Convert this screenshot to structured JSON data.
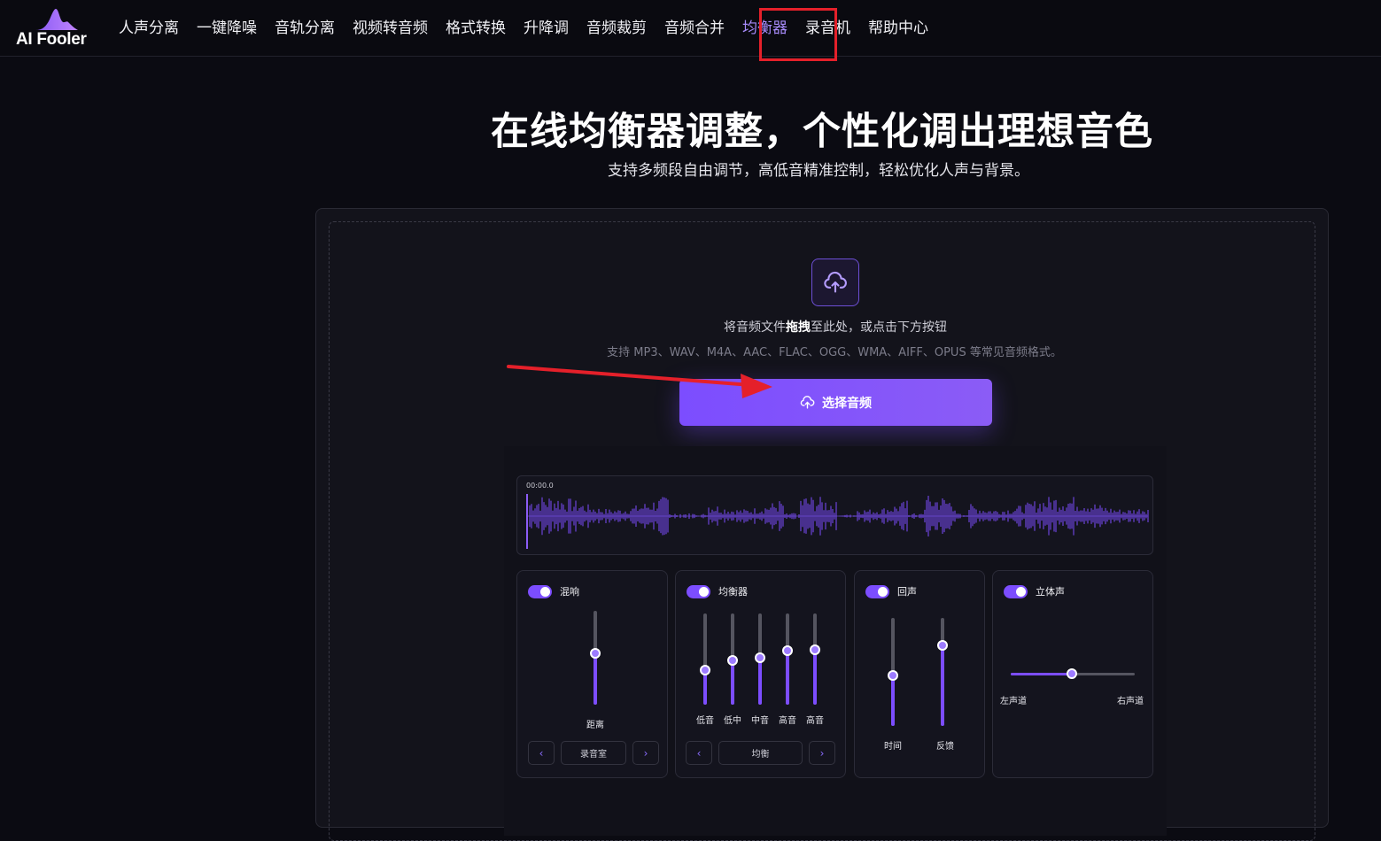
{
  "brand": {
    "name": "AI Fooler"
  },
  "nav": {
    "items": [
      "人声分离",
      "一键降噪",
      "音轨分离",
      "视频转音频",
      "格式转换",
      "升降调",
      "音频裁剪",
      "音频合并",
      "均衡器",
      "录音机",
      "帮助中心"
    ],
    "active_index": 8
  },
  "hero": {
    "title": "在线均衡器调整，个性化调出理想音色",
    "subtitle": "支持多频段自由调节，高低音精准控制，轻松优化人声与背景。"
  },
  "upload": {
    "drop_prefix": "将音频文件",
    "drop_bold": "拖拽",
    "drop_suffix": "至此处，或点击下方按钮",
    "formats": "支持 MP3、WAV、M4A、AAC、FLAC、OGG、WMA、AIFF、OPUS 等常见音频格式。",
    "button_label": "选择音频"
  },
  "preview": {
    "time": "00:00.0",
    "reverb": {
      "title": "混响",
      "enabled": true,
      "distance_label": "距离",
      "distance_level": 0.55,
      "preset": "录音室"
    },
    "equalizer": {
      "title": "均衡器",
      "enabled": true,
      "bands": [
        {
          "label": "低音",
          "level": 0.38
        },
        {
          "label": "低中",
          "level": 0.49
        },
        {
          "label": "中音",
          "level": 0.51
        },
        {
          "label": "高音",
          "level": 0.59
        },
        {
          "label": "高音",
          "level": 0.6
        }
      ],
      "preset": "均衡"
    },
    "echo": {
      "title": "回声",
      "enabled": true,
      "sliders": [
        {
          "label": "时间",
          "level": 0.47
        },
        {
          "label": "反馈",
          "level": 0.75
        }
      ]
    },
    "stereo": {
      "title": "立体声",
      "enabled": true,
      "left_label": "左声道",
      "right_label": "右声道",
      "balance": 0.49
    }
  },
  "colors": {
    "accent": "#7c4dff",
    "highlight_box": "#e5202a",
    "background": "#0b0b12"
  }
}
